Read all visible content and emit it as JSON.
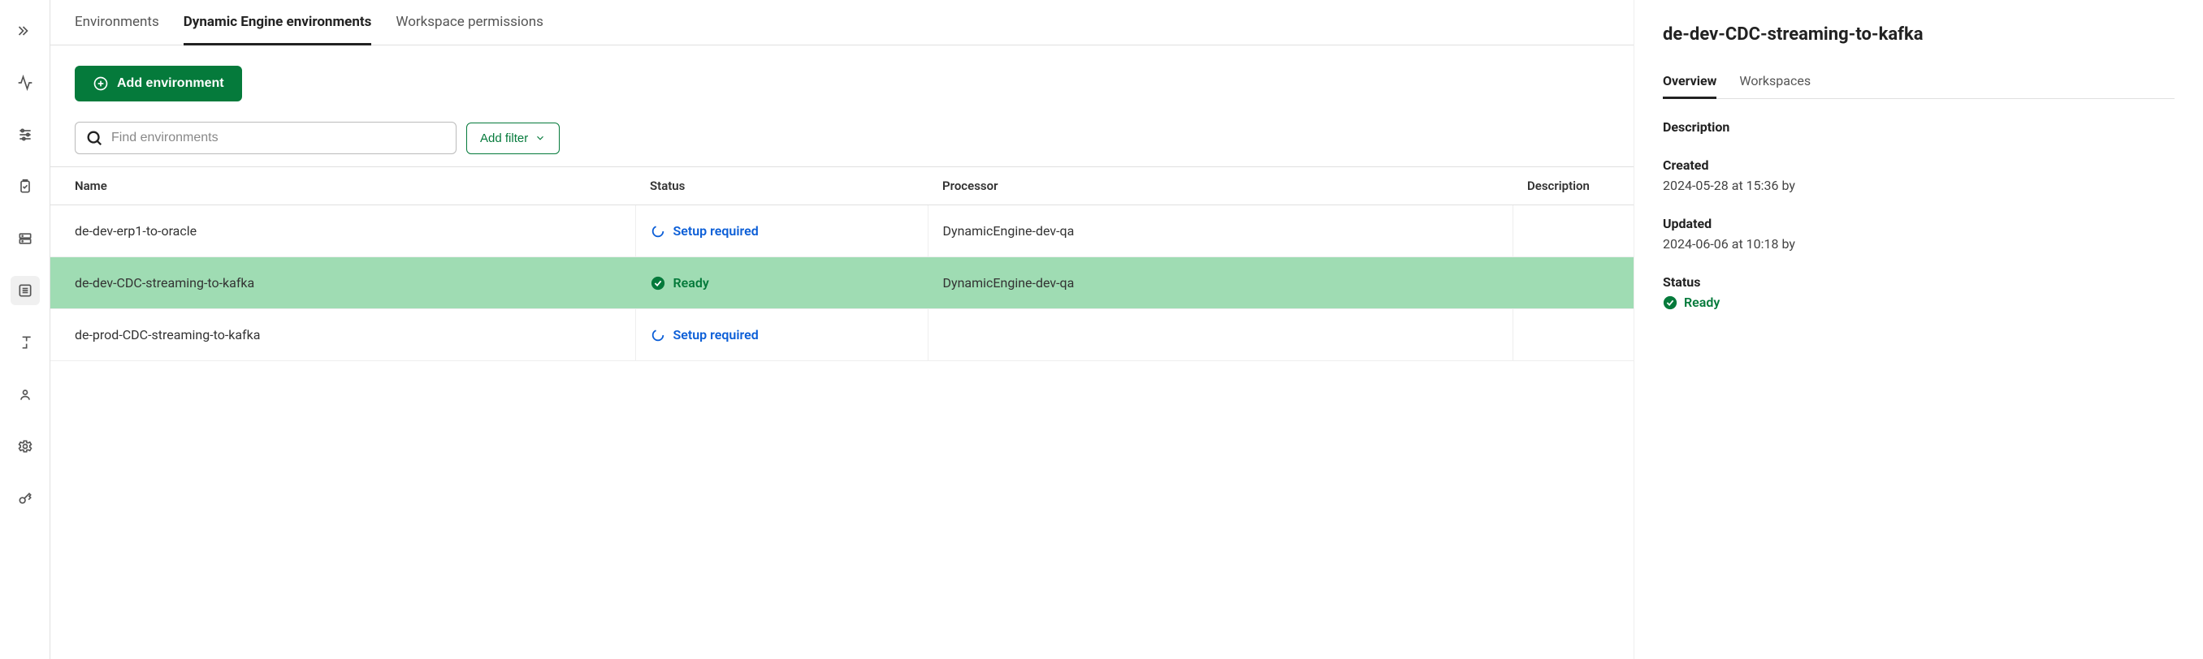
{
  "tabs": {
    "items": [
      "Environments",
      "Dynamic Engine environments",
      "Workspace permissions"
    ],
    "active": 1
  },
  "toolbar": {
    "add_label": "Add environment"
  },
  "search": {
    "placeholder": "Find environments"
  },
  "filter": {
    "label": "Add filter"
  },
  "table": {
    "headers": [
      "Name",
      "Status",
      "Processor",
      "Description"
    ],
    "rows": [
      {
        "name": "de-dev-erp1-to-oracle",
        "status": "Setup required",
        "status_kind": "setup",
        "processor": "DynamicEngine-dev-qa",
        "description": "",
        "selected": false
      },
      {
        "name": "de-dev-CDC-streaming-to-kafka",
        "status": "Ready",
        "status_kind": "ready",
        "processor": "DynamicEngine-dev-qa",
        "description": "",
        "selected": true
      },
      {
        "name": "de-prod-CDC-streaming-to-kafka",
        "status": "Setup required",
        "status_kind": "setup",
        "processor": "",
        "description": "",
        "selected": false
      }
    ]
  },
  "detail": {
    "title": "de-dev-CDC-streaming-to-kafka",
    "tabs": [
      "Overview",
      "Workspaces"
    ],
    "active_tab": 0,
    "description_label": "Description",
    "created_label": "Created",
    "created_value": "2024-05-28 at 15:36 by",
    "updated_label": "Updated",
    "updated_value": "2024-06-06 at 10:18 by",
    "status_label": "Status",
    "status_value": "Ready"
  }
}
